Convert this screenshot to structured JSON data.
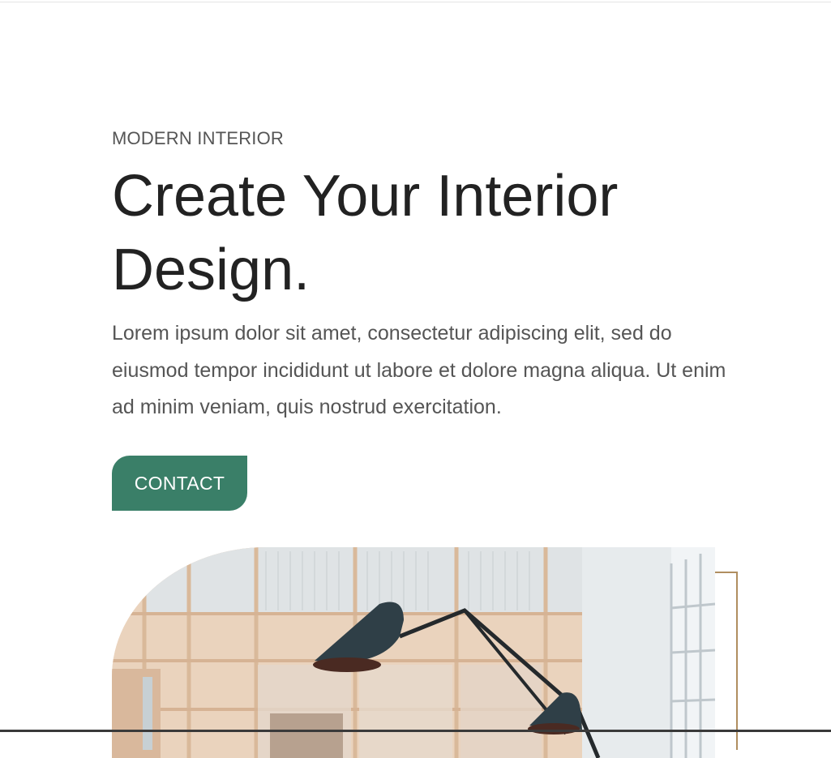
{
  "hero": {
    "eyebrow": "MODERN INTERIOR",
    "title": "Create Your Interior Design.",
    "description": "Lorem ipsum dolor sit amet, consectetur adipiscing elit, sed do eiusmod tempor incididunt ut labore et dolore magna aliqua. Ut enim ad minim veniam, quis nostrud exercitation.",
    "cta_label": "CONTACT"
  },
  "colors": {
    "accent": "#3a7f68",
    "frame": "#b08e60",
    "heading": "#222222",
    "body_text": "#555555"
  },
  "image": {
    "subject": "interior-photo-pendant-lamp"
  }
}
